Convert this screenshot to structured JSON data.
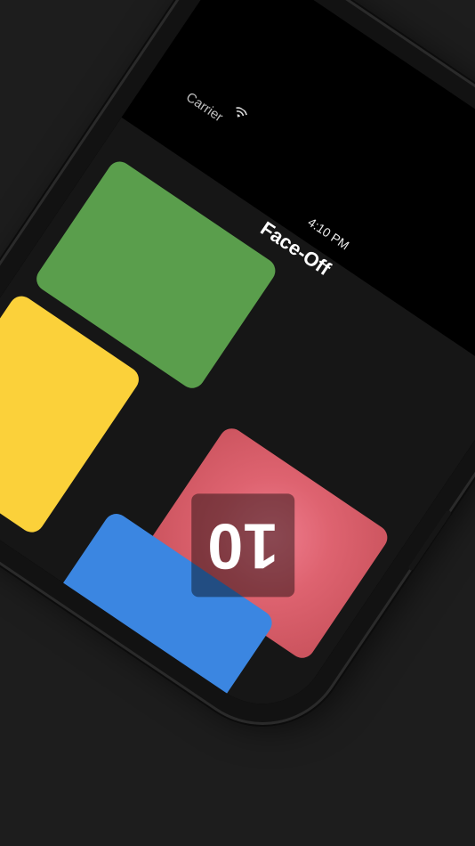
{
  "status_bar": {
    "carrier": "Carrier",
    "time": "4:10 PM",
    "wifi_icon": "wifi-icon",
    "battery_icon": "battery-icon"
  },
  "nav": {
    "title": "Face-Off"
  },
  "game": {
    "countdown": "10",
    "tiles": [
      {
        "color": "green",
        "hex": "#5a9e4c"
      },
      {
        "color": "red",
        "hex": "#de6370"
      },
      {
        "color": "yellow",
        "hex": "#fbd13a"
      },
      {
        "color": "blue",
        "hex": "#3b86e1"
      },
      {
        "color": "light-blue",
        "hex": "#5aaef0"
      },
      {
        "color": "yellow",
        "hex": "#fbd13a"
      },
      {
        "color": "green",
        "hex": "#5a9e4c"
      }
    ]
  },
  "colors": {
    "background": "#1d1d1d",
    "app_bg": "#161616"
  }
}
